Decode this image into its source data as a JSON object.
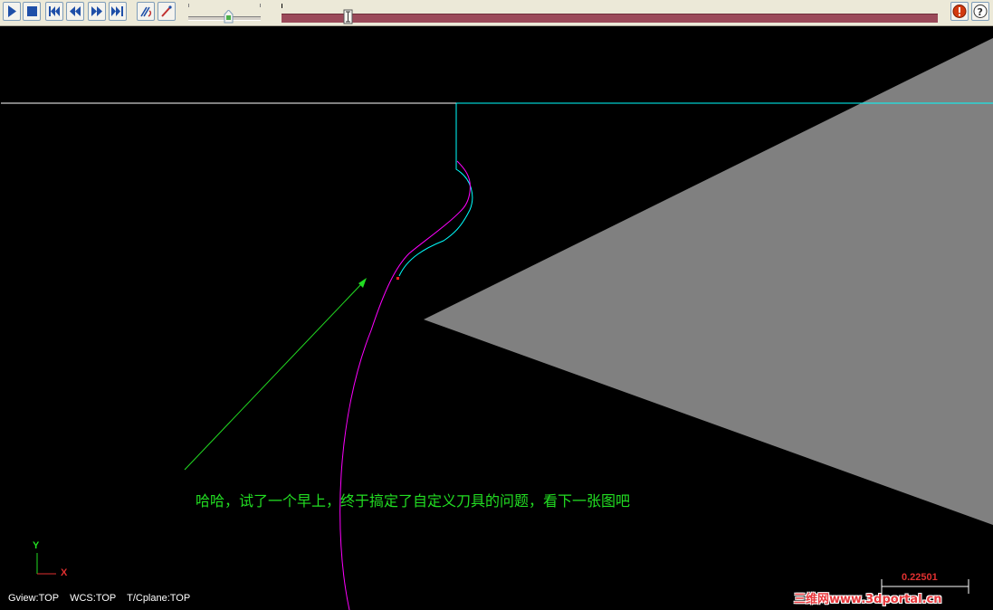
{
  "toolbar": {
    "buttons": [
      {
        "name": "play-button",
        "icon": "play-icon"
      },
      {
        "name": "stop-button",
        "icon": "stop-icon"
      },
      {
        "name": "rewind-to-start-button",
        "icon": "skip-back-icon"
      },
      {
        "name": "step-back-button",
        "icon": "step-back-icon"
      },
      {
        "name": "step-forward-button",
        "icon": "step-forward-icon"
      },
      {
        "name": "skip-to-end-button",
        "icon": "skip-forward-icon"
      },
      {
        "name": "show-toolpath-button",
        "icon": "toolpath-icon"
      },
      {
        "name": "show-tool-button",
        "icon": "tool-icon"
      },
      {
        "name": "stop-options-button",
        "icon": "stop-sign-icon"
      },
      {
        "name": "help-button",
        "icon": "help-icon"
      }
    ],
    "speed_level": 0.55,
    "progress_level": 0.1
  },
  "colors": {
    "background": "#000000",
    "stock_top_line": "#ffffff",
    "tool_profile": "#808080",
    "toolpath": "#00ffff",
    "tool_arc": "#ff00ff",
    "annotation": "#22dd22",
    "progress_bar": "#9b4a5a"
  },
  "annotation": {
    "text": "哈哈，试了一个早上，终于搞定了自定义刀具的问题，看下一张图吧"
  },
  "view_status": {
    "gview": "Gview:TOP",
    "wcs": "WCS:TOP",
    "tcplane": "T/Cplane:TOP"
  },
  "axis_indicator": {
    "y_label": "Y",
    "x_label": "X"
  },
  "scale_bar": {
    "value": "0.22501"
  },
  "watermark": {
    "text": "三维网www.3dportal.cn"
  }
}
